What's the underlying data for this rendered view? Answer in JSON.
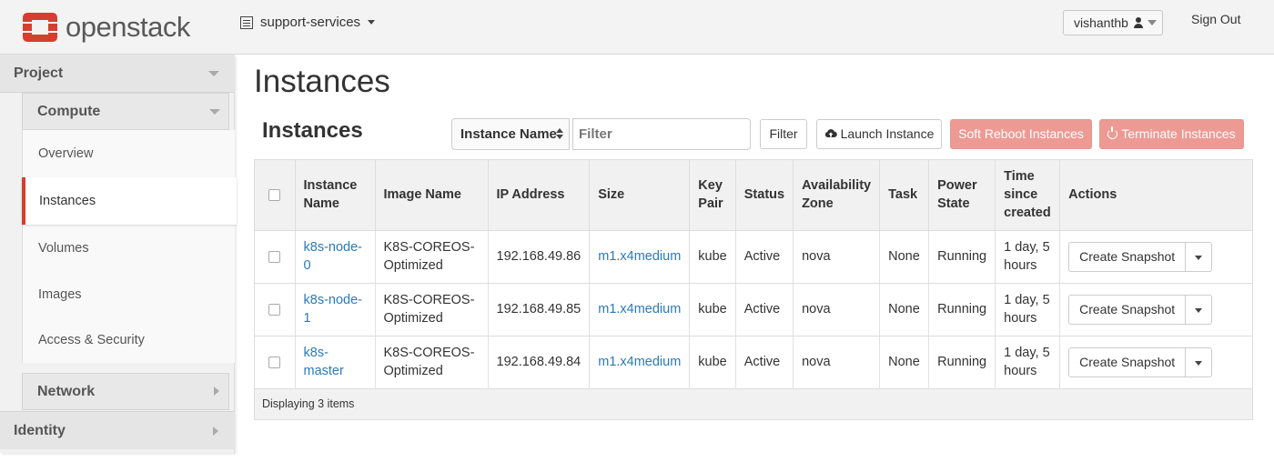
{
  "brand": {
    "name": "openstack",
    "color": "#d63e2f"
  },
  "header": {
    "project": "support-services",
    "user": "vishanthb",
    "signout": "Sign Out"
  },
  "sidebar": {
    "project": "Project",
    "compute": "Compute",
    "items": [
      {
        "label": "Overview"
      },
      {
        "label": "Instances"
      },
      {
        "label": "Volumes"
      },
      {
        "label": "Images"
      },
      {
        "label": "Access & Security"
      }
    ],
    "network": "Network",
    "identity": "Identity"
  },
  "main": {
    "page_title": "Instances",
    "section_title": "Instances",
    "filter_field": "Instance Name",
    "filter_placeholder": "Filter",
    "filter_btn": "Filter",
    "launch_btn": "Launch Instance",
    "soft_reboot_btn": "Soft Reboot Instances",
    "terminate_btn": "Terminate Instances"
  },
  "table": {
    "headers": {
      "name": "Instance Name",
      "image": "Image Name",
      "ip": "IP Address",
      "size": "Size",
      "keypair": "Key Pair",
      "status": "Status",
      "zone": "Availability Zone",
      "task": "Task",
      "power": "Power State",
      "time": "Time since created",
      "actions": "Actions"
    },
    "rows": [
      {
        "name": "k8s-node-0",
        "image": "K8S-COREOS-Optimized",
        "ip": "192.168.49.86",
        "size": "m1.x4medium",
        "keypair": "kube",
        "status": "Active",
        "zone": "nova",
        "task": "None",
        "power": "Running",
        "time": "1 day, 5 hours",
        "action": "Create Snapshot"
      },
      {
        "name": "k8s-node-1",
        "image": "K8S-COREOS-Optimized",
        "ip": "192.168.49.85",
        "size": "m1.x4medium",
        "keypair": "kube",
        "status": "Active",
        "zone": "nova",
        "task": "None",
        "power": "Running",
        "time": "1 day, 5 hours",
        "action": "Create Snapshot"
      },
      {
        "name": "k8s-master",
        "image": "K8S-COREOS-Optimized",
        "ip": "192.168.49.84",
        "size": "m1.x4medium",
        "keypair": "kube",
        "status": "Active",
        "zone": "nova",
        "task": "None",
        "power": "Running",
        "time": "1 day, 5 hours",
        "action": "Create Snapshot"
      }
    ],
    "footer": "Displaying 3 items"
  },
  "icons": [
    "openstack-logo-icon",
    "project-list-icon",
    "user-icon",
    "cloud-upload-icon",
    "power-icon"
  ]
}
